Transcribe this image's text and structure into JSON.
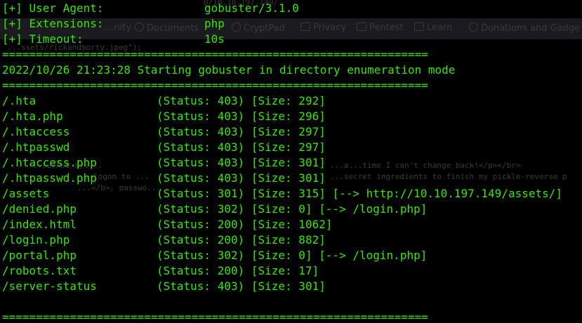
{
  "header": {
    "rows": [
      {
        "label": "[+] User Agent:",
        "value": "gobuster/3.1.0"
      },
      {
        "label": "[+] Extensions:",
        "value": "php"
      },
      {
        "label": "[+] Timeout:",
        "value": "10s"
      }
    ],
    "separator": "===============================================================",
    "start_message": "2022/10/26 21:23:28 Starting gobuster in directory enumeration mode"
  },
  "results": [
    {
      "path": "/.hta",
      "status": "(Status: 403)",
      "size": "[Size: 292]",
      "redirect": ""
    },
    {
      "path": "/.hta.php",
      "status": "(Status: 403)",
      "size": "[Size: 296]",
      "redirect": ""
    },
    {
      "path": "/.htaccess",
      "status": "(Status: 403)",
      "size": "[Size: 297]",
      "redirect": ""
    },
    {
      "path": "/.htpasswd",
      "status": "(Status: 403)",
      "size": "[Size: 297]",
      "redirect": ""
    },
    {
      "path": "/.htaccess.php",
      "status": "(Status: 403)",
      "size": "[Size: 301]",
      "redirect": ""
    },
    {
      "path": "/.htpasswd.php",
      "status": "(Status: 403)",
      "size": "[Size: 301]",
      "redirect": ""
    },
    {
      "path": "/assets",
      "status": "(Status: 301)",
      "size": "[Size: 315]",
      "redirect": "[--> http://10.10.197.149/assets/]"
    },
    {
      "path": "/denied.php",
      "status": "(Status: 302)",
      "size": "[Size: 0]",
      "redirect": "[--> /login.php]"
    },
    {
      "path": "/index.html",
      "status": "(Status: 200)",
      "size": "[Size: 1062]",
      "redirect": ""
    },
    {
      "path": "/login.php",
      "status": "(Status: 200)",
      "size": "[Size: 882]",
      "redirect": ""
    },
    {
      "path": "/portal.php",
      "status": "(Status: 302)",
      "size": "[Size: 0]",
      "redirect": "[--> /login.php]"
    },
    {
      "path": "/robots.txt",
      "status": "(Status: 200)",
      "size": "[Size: 17]",
      "redirect": ""
    },
    {
      "path": "/server-status",
      "status": "(Status: 403)",
      "size": "[Size: 301]",
      "redirect": ""
    }
  ],
  "footer_separator": "===============================================================",
  "background_ghost": {
    "url_fragment": "0/10.10.197.149/",
    "bookmarks": [
      "...nity",
      "Documents",
      "CryptPad",
      "Privacy",
      "Pentest",
      "Learn",
      "Donations and Gadge"
    ],
    "code_1": "...ssets/rickandmorty.jpeg\");",
    "code_2": "...turned mys...",
    "code_3": "...a...time I can't change back!</p></br>",
    "code_4": "..., logon to ...",
    "code_5": "...secret ingredients to finish my pickle-reverse p",
    "code_6": "...</b>, passwo..."
  },
  "colors": {
    "foreground": "#39e600",
    "background": "#000000"
  }
}
